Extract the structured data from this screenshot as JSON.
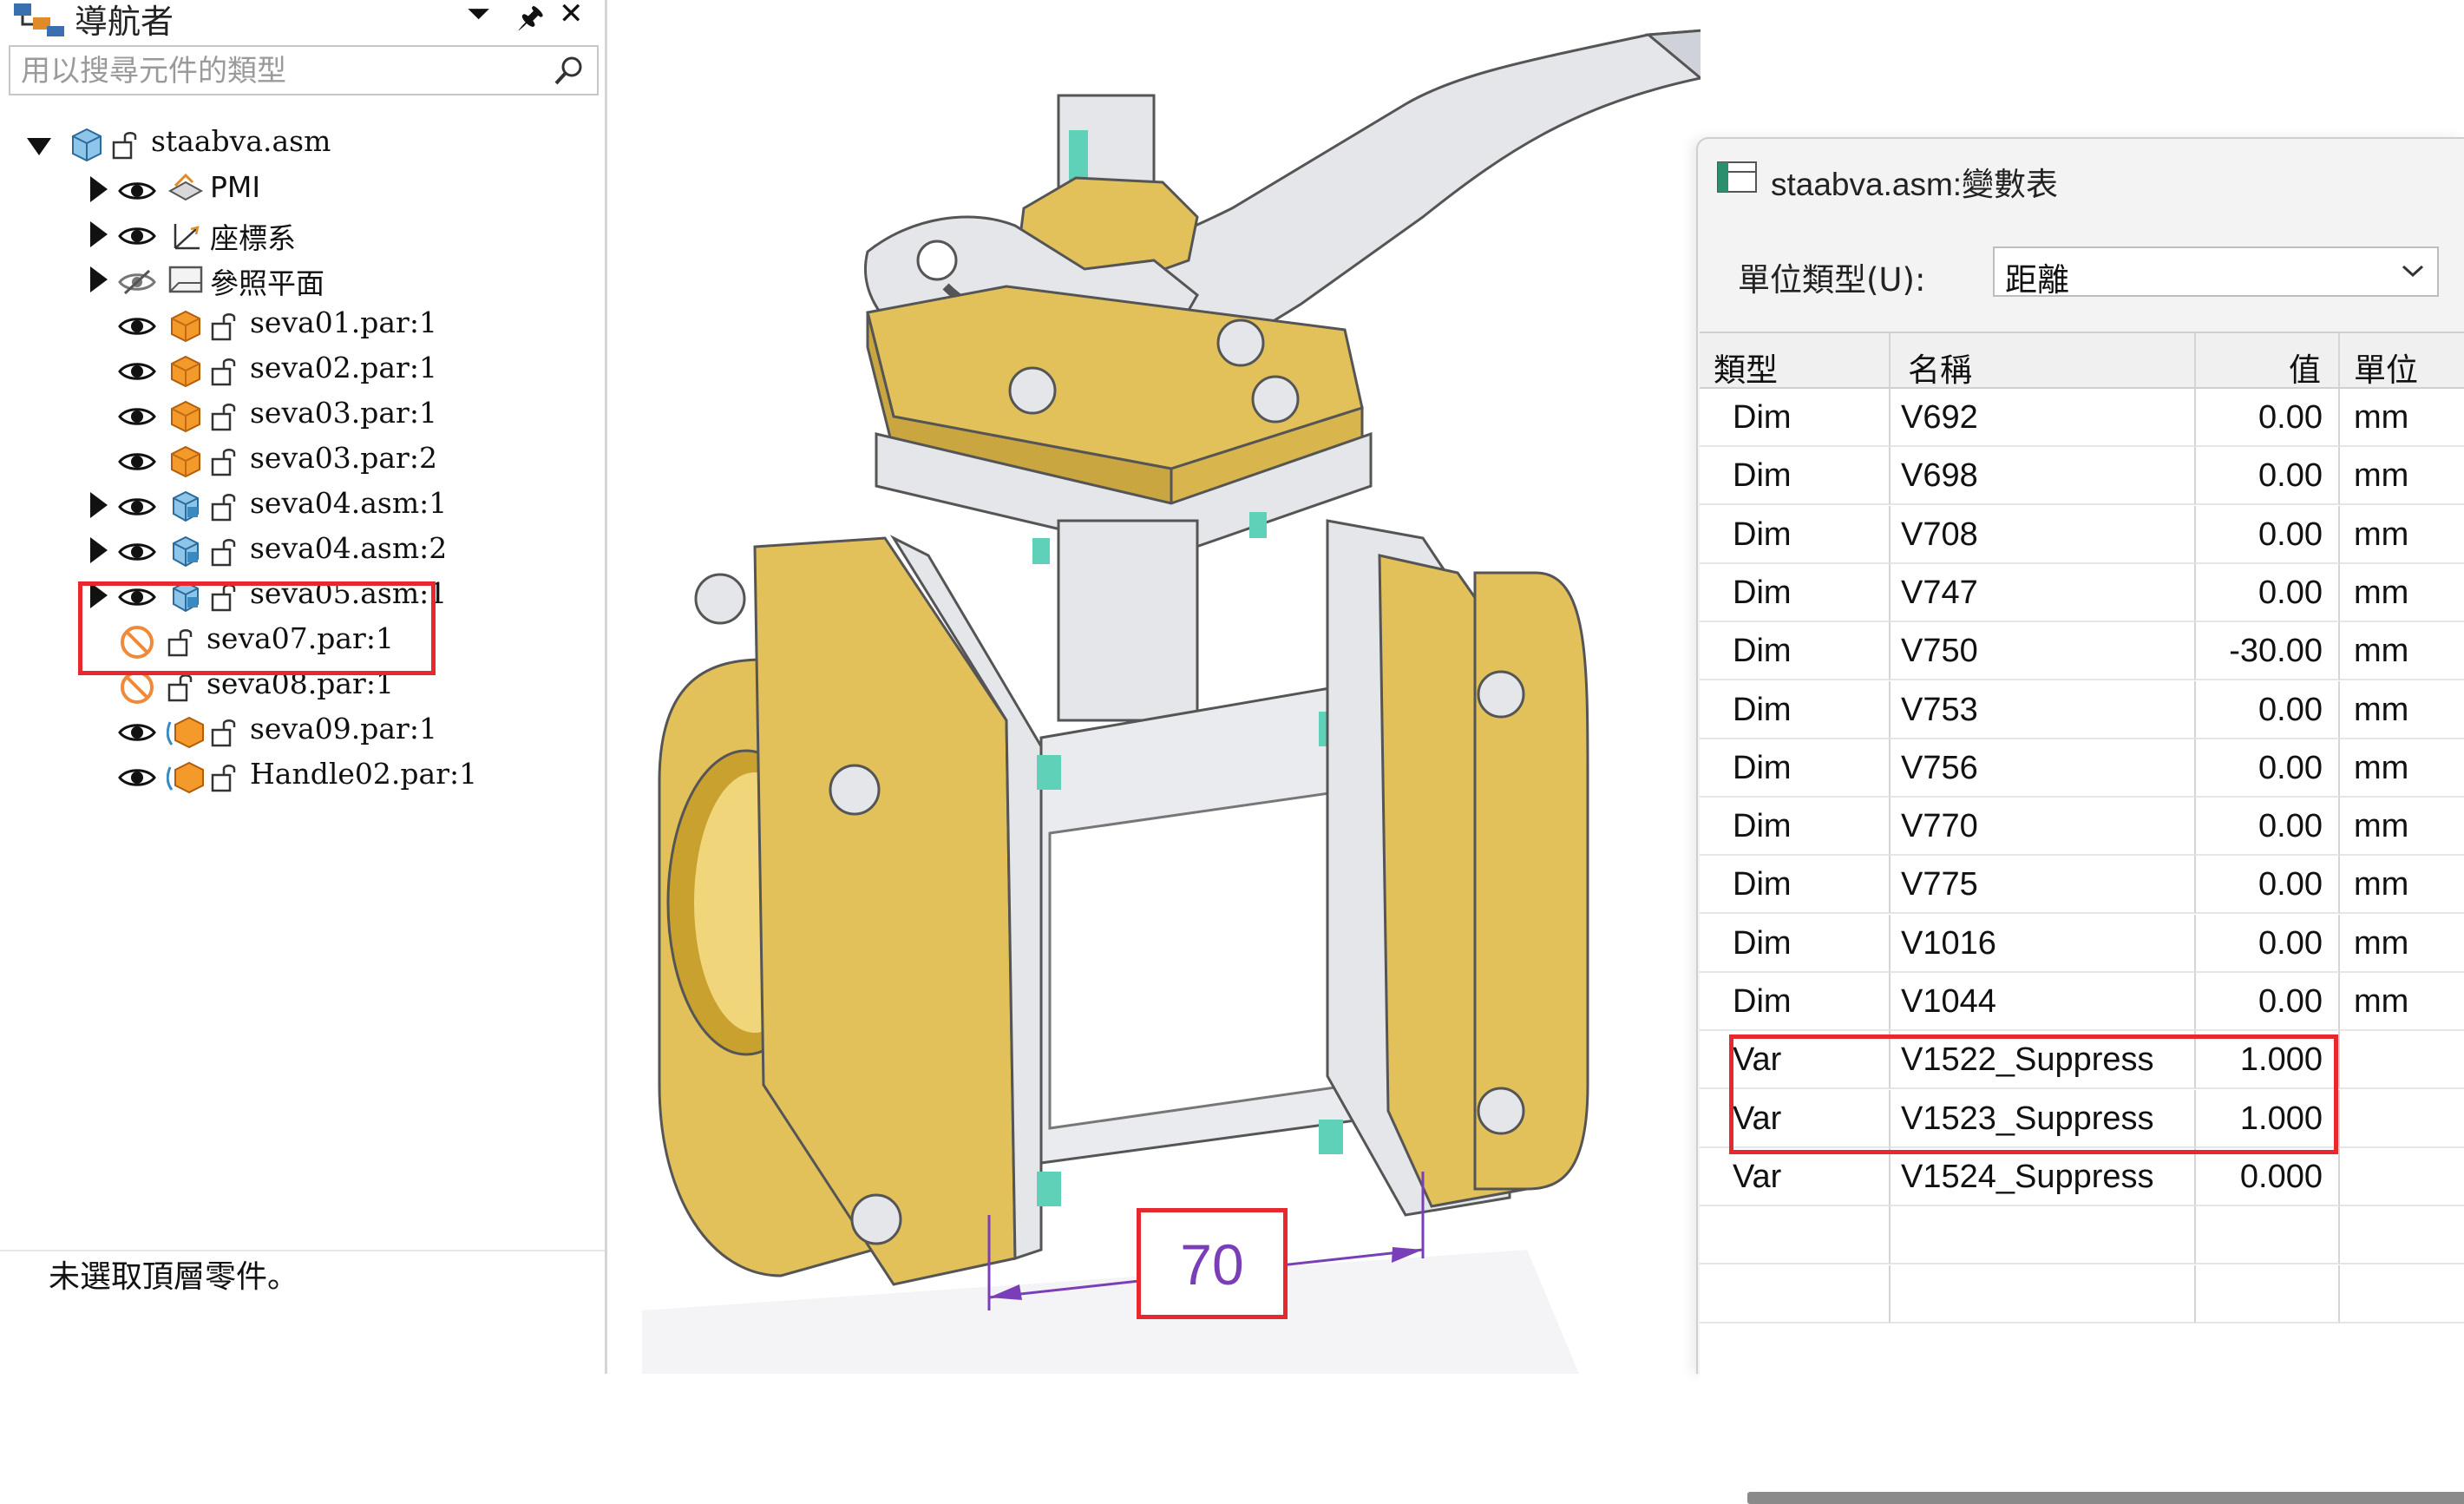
{
  "navigator": {
    "title": "導航者",
    "search_placeholder": "用以搜尋元件的類型",
    "status_text": "未選取頂層零件。",
    "tree": [
      {
        "label": "staabva.asm",
        "kind": "assembly-root"
      },
      {
        "label": "PMI",
        "kind": "pmi"
      },
      {
        "label": "座標系",
        "kind": "coordinate-system"
      },
      {
        "label": "參照平面",
        "kind": "reference-plane"
      },
      {
        "label": "seva01.par:1",
        "kind": "part"
      },
      {
        "label": "seva02.par:1",
        "kind": "part"
      },
      {
        "label": "seva03.par:1",
        "kind": "part"
      },
      {
        "label": "seva03.par:2",
        "kind": "part"
      },
      {
        "label": "seva04.asm:1",
        "kind": "subassembly"
      },
      {
        "label": "seva04.asm:2",
        "kind": "subassembly"
      },
      {
        "label": "seva05.asm:1",
        "kind": "subassembly"
      },
      {
        "label": "seva07.par:1",
        "kind": "suppressed-part"
      },
      {
        "label": "seva08.par:1",
        "kind": "suppressed-part"
      },
      {
        "label": "seva09.par:1",
        "kind": "adjustable-part"
      },
      {
        "label": "Handle02.par:1",
        "kind": "adjustable-part"
      }
    ]
  },
  "viewport": {
    "dimension_value": "70"
  },
  "variable_table": {
    "title": "staabva.asm:變數表",
    "unit_type_label": "單位類型(U):",
    "unit_type_value": "距離",
    "columns": [
      "類型",
      "名稱",
      "值",
      "單位"
    ],
    "rows": [
      {
        "type": "Dim",
        "name": "V692",
        "value": "0.00",
        "unit": "mm"
      },
      {
        "type": "Dim",
        "name": "V698",
        "value": "0.00",
        "unit": "mm"
      },
      {
        "type": "Dim",
        "name": "V708",
        "value": "0.00",
        "unit": "mm"
      },
      {
        "type": "Dim",
        "name": "V747",
        "value": "0.00",
        "unit": "mm"
      },
      {
        "type": "Dim",
        "name": "V750",
        "value": "-30.00",
        "unit": "mm"
      },
      {
        "type": "Dim",
        "name": "V753",
        "value": "0.00",
        "unit": "mm"
      },
      {
        "type": "Dim",
        "name": "V756",
        "value": "0.00",
        "unit": "mm"
      },
      {
        "type": "Dim",
        "name": "V770",
        "value": "0.00",
        "unit": "mm"
      },
      {
        "type": "Dim",
        "name": "V775",
        "value": "0.00",
        "unit": "mm"
      },
      {
        "type": "Dim",
        "name": "V1016",
        "value": "0.00",
        "unit": "mm"
      },
      {
        "type": "Dim",
        "name": "V1044",
        "value": "0.00",
        "unit": "mm"
      },
      {
        "type": "Var",
        "name": "V1522_Suppress",
        "value": "1.000",
        "unit": ""
      },
      {
        "type": "Var",
        "name": "V1523_Suppress",
        "value": "1.000",
        "unit": ""
      },
      {
        "type": "Var",
        "name": "V1524_Suppress",
        "value": "0.000",
        "unit": ""
      }
    ]
  },
  "colors": {
    "highlight": "#e8282f",
    "brass": "#e2c15a",
    "steel": "#e4e6ea",
    "bolt_accent": "#5fd1b8",
    "dimension": "#7a3fb8",
    "part_icon": "#f39a2b"
  }
}
